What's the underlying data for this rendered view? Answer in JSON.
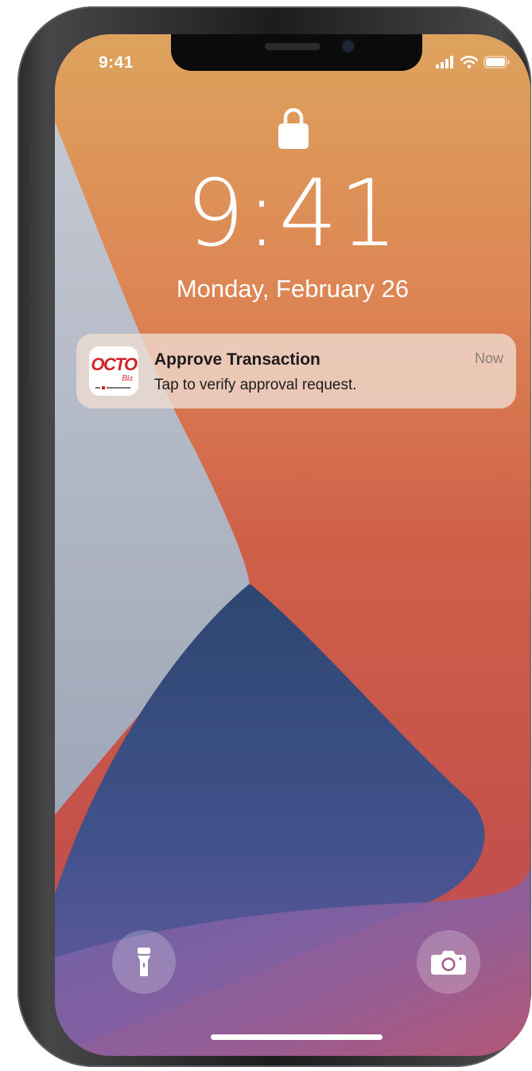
{
  "status_bar": {
    "time": "9:41",
    "icons": [
      "cellular-signal-icon",
      "wifi-icon",
      "battery-icon"
    ]
  },
  "lock_screen": {
    "lock_icon": "padlock-icon",
    "time": "9:41",
    "date": "Monday, February 26"
  },
  "notification": {
    "app_icon": {
      "logo_text": "OCTO",
      "logo_subtext": "Biz"
    },
    "title": "Approve Transaction",
    "body": "Tap to verify approval request.",
    "time": "Now"
  },
  "quick_actions": {
    "left": "flashlight-icon",
    "right": "camera-icon"
  },
  "colors": {
    "wallpaper_orange": "#E39A52",
    "wallpaper_red": "#C8564A",
    "wallpaper_blue": "#3C4F84",
    "wallpaper_gray": "#B9BFCC",
    "brand_red": "#D1232A"
  }
}
